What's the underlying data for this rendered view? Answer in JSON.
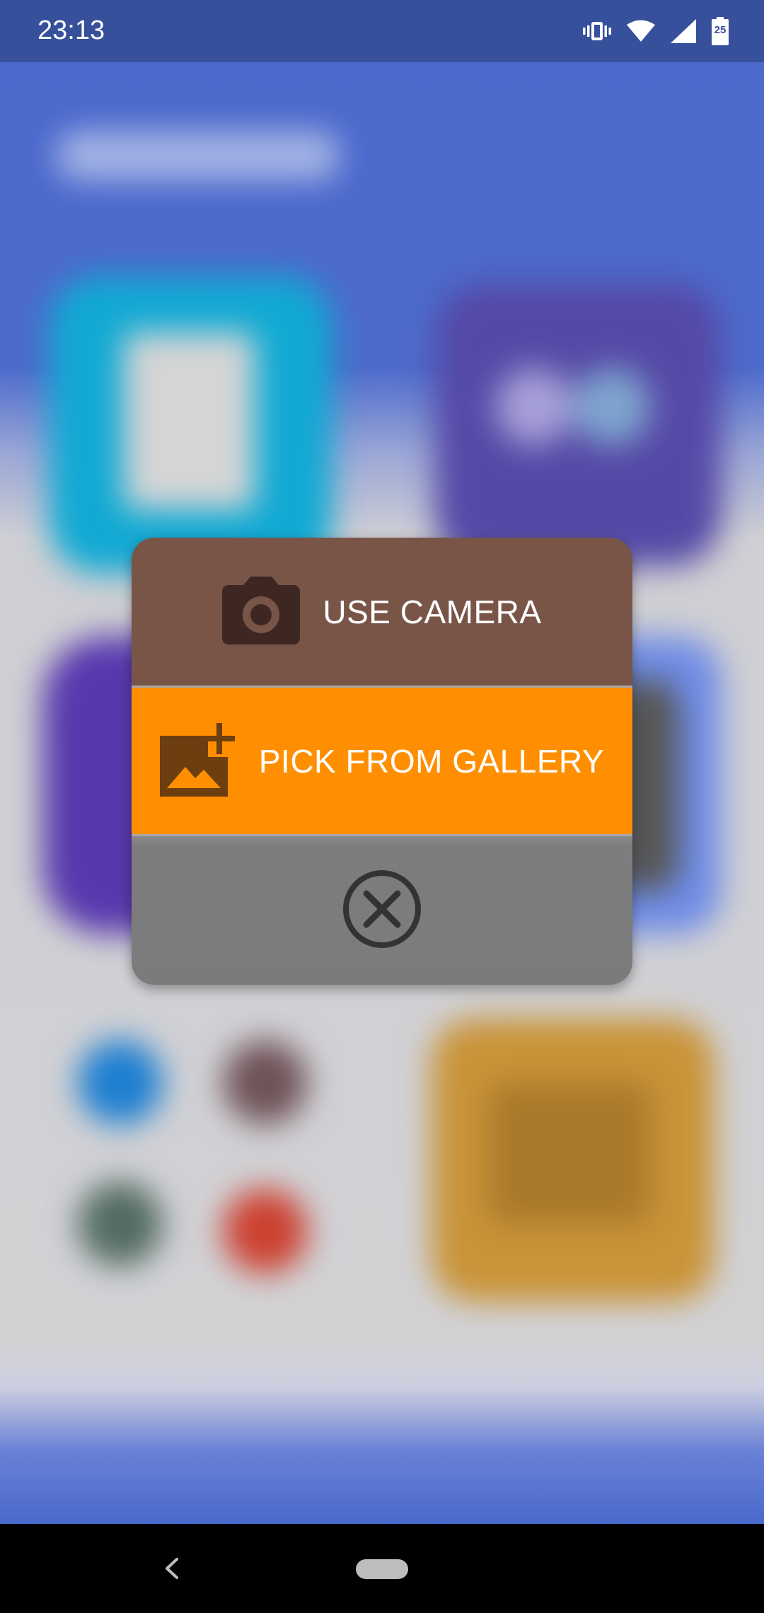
{
  "status_bar": {
    "time": "23:13",
    "battery_level": "25",
    "icons": [
      "vibrate-icon",
      "wifi-icon",
      "cellular-signal-icon",
      "battery-icon"
    ]
  },
  "dialog": {
    "camera_label": "USE CAMERA",
    "camera_icon": "camera-icon",
    "gallery_label": "PICK FROM GALLERY",
    "gallery_icon": "add-photo-icon",
    "close_icon": "close-circle-icon"
  },
  "colors": {
    "camera_bg": "#795548",
    "gallery_bg": "#ff8f00",
    "close_bg": "#7b7b7b",
    "status_bar_bg": "#36509c"
  },
  "navigation_bar": {
    "back_icon": "back-chevron-icon",
    "home_icon": "home-pill-icon"
  }
}
